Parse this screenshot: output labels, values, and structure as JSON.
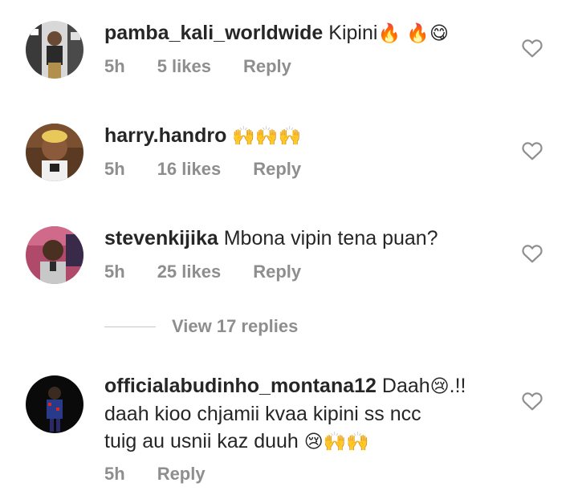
{
  "comments": [
    {
      "username": "pamba_kali_worldwide",
      "text": "Kipini",
      "emoji": "🔥 🔥😋",
      "time": "5h",
      "likes": "5 likes",
      "reply": "Reply"
    },
    {
      "username": "harry.handro",
      "text": "",
      "emoji": "🙌🙌🙌",
      "time": "5h",
      "likes": "16 likes",
      "reply": "Reply"
    },
    {
      "username": "stevenkijika",
      "text": "Mbona vipin tena puan?",
      "emoji": "",
      "time": "5h",
      "likes": "25 likes",
      "reply": "Reply"
    },
    {
      "username": "officialabudinho_montana12",
      "text": "Daah",
      "emoji": "😢",
      "text_after": ".!!",
      "text_line2": "daah kioo chjamii kvaa kipini ss ncc",
      "text_line3": "tuig au usnii kaz duuh",
      "emoji_line3": "😢🙌🙌",
      "time": "5h",
      "reply": "Reply"
    }
  ],
  "view_replies": "View 17 replies",
  "colors": {
    "primary_text": "#262626",
    "secondary_text": "#8e8e8e",
    "divider": "#c7c7c7",
    "heart_outline": "#8e8e8e"
  },
  "icons": {
    "like": "heart-outline-icon"
  }
}
